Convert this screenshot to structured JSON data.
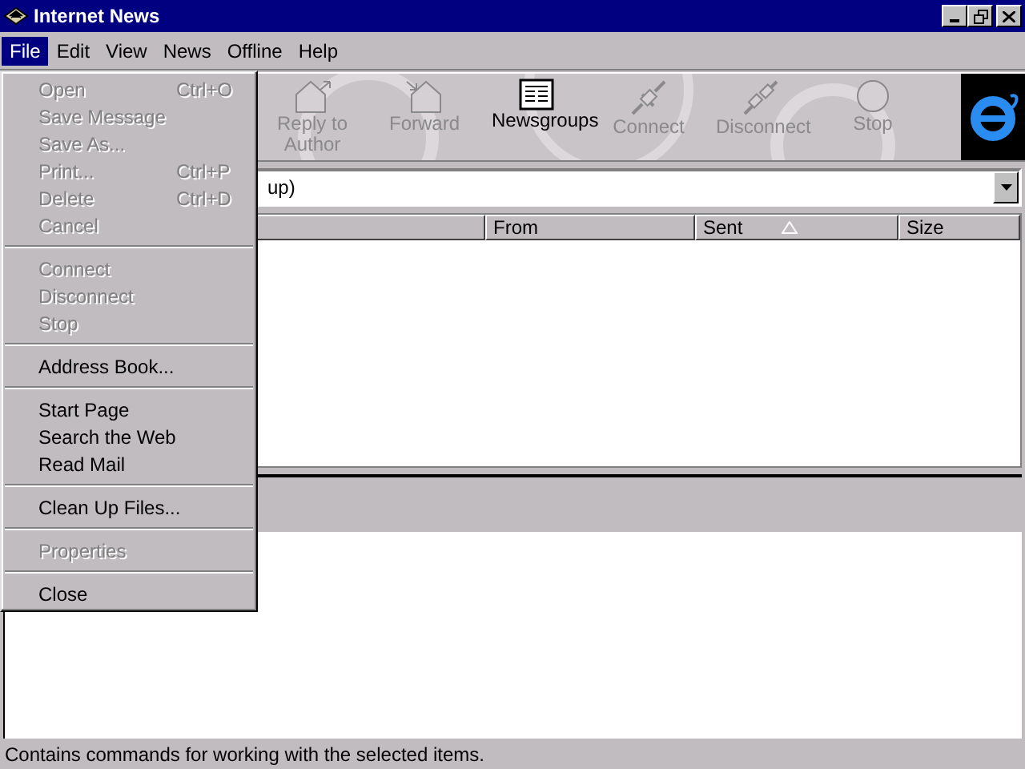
{
  "window": {
    "title": "Internet News"
  },
  "menu_bar": [
    {
      "label": "File",
      "selected": true
    },
    {
      "label": "Edit",
      "selected": false
    },
    {
      "label": "View",
      "selected": false
    },
    {
      "label": "News",
      "selected": false
    },
    {
      "label": "Offline",
      "selected": false
    },
    {
      "label": "Help",
      "selected": false
    }
  ],
  "file_menu": [
    [
      {
        "label": "Open",
        "shortcut": "Ctrl+O",
        "disabled": true
      },
      {
        "label": "Save Message",
        "disabled": true
      },
      {
        "label": "Save As...",
        "disabled": true
      },
      {
        "label": "Print...",
        "shortcut": "Ctrl+P",
        "disabled": true
      },
      {
        "label": "Delete",
        "shortcut": "Ctrl+D",
        "disabled": true
      },
      {
        "label": "Cancel",
        "disabled": true
      }
    ],
    [
      {
        "label": "Connect",
        "disabled": true
      },
      {
        "label": "Disconnect",
        "disabled": true
      },
      {
        "label": "Stop",
        "disabled": true
      }
    ],
    [
      {
        "label": "Address Book...",
        "disabled": false
      }
    ],
    [
      {
        "label": "Start Page",
        "disabled": false
      },
      {
        "label": "Search the Web",
        "disabled": false
      },
      {
        "label": "Read Mail",
        "disabled": false
      }
    ],
    [
      {
        "label": "Clean Up Files...",
        "disabled": false
      }
    ],
    [
      {
        "label": "Properties",
        "disabled": true
      }
    ],
    [
      {
        "label": "Close",
        "disabled": false
      }
    ]
  ],
  "toolbar": [
    {
      "kind": "reply",
      "label": "Reply to Author",
      "disabled": true
    },
    {
      "kind": "forward",
      "label": "Forward",
      "disabled": true
    },
    {
      "kind": "newsgroups",
      "label": "Newsgroups",
      "disabled": false
    },
    {
      "kind": "connect",
      "label": "Connect",
      "disabled": true
    },
    {
      "kind": "disconnect",
      "label": "Disconnect",
      "disabled": true
    },
    {
      "kind": "stop",
      "label": "Stop",
      "disabled": true
    }
  ],
  "newsgroup_field": {
    "value": "up)"
  },
  "columns": [
    {
      "label": "From"
    },
    {
      "label": "Sent",
      "sorted": true
    },
    {
      "label": "Size"
    }
  ],
  "status_bar": {
    "text": "Contains commands for working with the selected items."
  }
}
